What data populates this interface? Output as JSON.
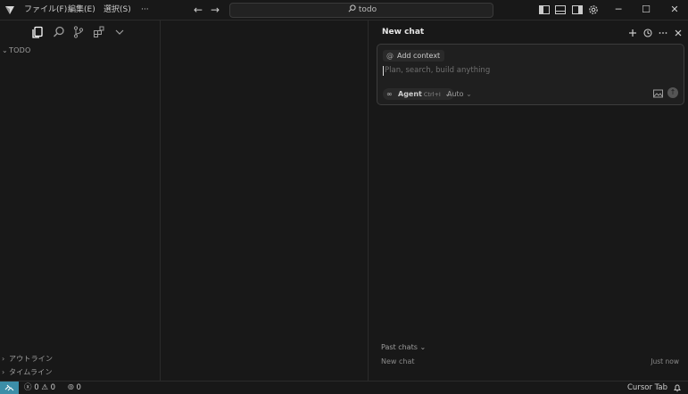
{
  "titlebar": {
    "menus": [
      "ファイル(F)",
      "編集(E)",
      "選択(S)",
      "···"
    ],
    "search_query": "todo",
    "window_controls": [
      "minimize",
      "maximize",
      "close"
    ]
  },
  "sidebar": {
    "tabs": [
      "explorer-icon",
      "search-icon",
      "source-control-icon",
      "extensions-icon",
      "chevron-down-icon"
    ],
    "sections": {
      "top": "TODO",
      "outline": "アウトライン",
      "timeline": "タイムライン"
    }
  },
  "chat": {
    "title": "New chat",
    "add_context": "Add context",
    "prompt_placeholder": "Plan, search, build anything",
    "agent_label": "Agent",
    "agent_shortcut": "Ctrl+I",
    "model_label": "Auto",
    "past_chats_label": "Past chats",
    "past_chats": [
      {
        "title": "New chat",
        "time": "Just now"
      }
    ]
  },
  "statusbar": {
    "errors": "0",
    "warnings": "0",
    "ports": "0",
    "right_label": "Cursor Tab"
  },
  "colors": {
    "background": "#181818",
    "border": "#2b2b2b",
    "remote_accent": "#3c8ea8"
  }
}
